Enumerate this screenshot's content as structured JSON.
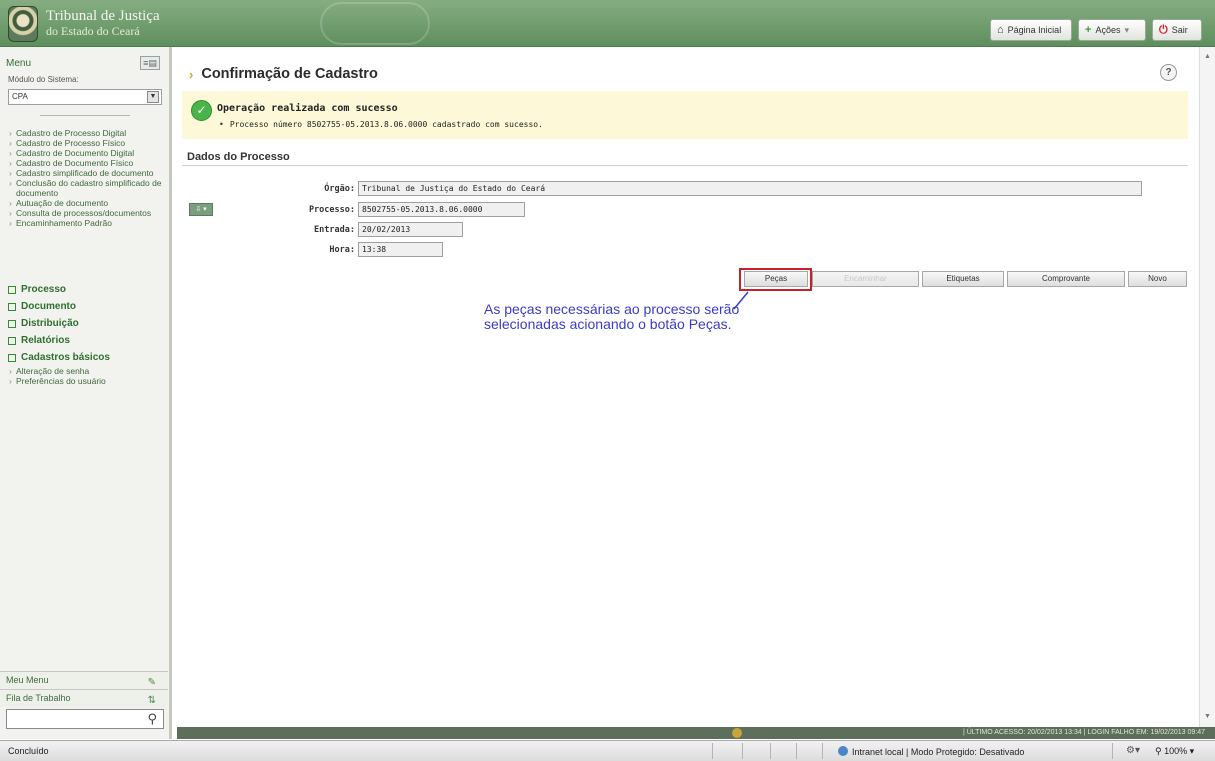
{
  "header": {
    "logo_line1": "Tribunal de Justiça",
    "logo_line2": "do Estado do Ceará",
    "home_label": "Página Inicial",
    "acoes_label": "Ações",
    "acoes_arrow": "▾",
    "sair_label": "Sair"
  },
  "sidebar": {
    "menu_label": "Menu",
    "module_label": "Módulo do Sistema:",
    "module_value": "CPA",
    "submenu": [
      "Cadastro de Processo Digital",
      "Cadastro de Processo Físico",
      "Cadastro de Documento Digital",
      "Cadastro de Documento Físico",
      "Cadastro simplificado de documento",
      "Conclusão do cadastro simplificado de documento",
      "Autuação de documento",
      "Consulta de processos/documentos",
      "Encaminhamento Padrão"
    ],
    "sections": {
      "processo": "Processo",
      "documento": "Documento",
      "distribuicao": "Distribuição",
      "relatorios": "Relatórios",
      "cadastros": "Cadastros básicos",
      "alteracao_senha": "Alteração de senha",
      "preferencias": "Preferências do usuário"
    },
    "meu_menu": "Meu Menu",
    "fila_trabalho": "Fila de Trabalho",
    "search_placeholder": ""
  },
  "main": {
    "title": "Confirmação de Cadastro",
    "help": "?",
    "success_title": "Operação realizada com sucesso",
    "success_detail": "Processo número 8502755-05.2013.8.06.0000 cadastrado com sucesso.",
    "section_title": "Dados do Processo",
    "fields": {
      "orgao_label": "Órgão:",
      "orgao_value": "Tribunal de Justiça do Estado do Ceará",
      "processo_label": "Processo:",
      "processo_value": "8502755-05.2013.8.06.0000",
      "entrada_label": "Entrada:",
      "entrada_value": "20/02/2013",
      "hora_label": "Hora:",
      "hora_value": "13:38"
    },
    "buttons": {
      "pecas": "Peças",
      "encaminhar": "Encaminhar",
      "etiquetas": "Etiquetas",
      "comprovante": "Comprovante",
      "novo": "Novo"
    },
    "callout": "As peças necessárias ao processo serão selecionadas acionando o botão Peças."
  },
  "info_bar": {
    "text": "|  ÚLTIMO ACESSO: 20/02/2013 13:34   |   LOGIN FALHO EM: 19/02/2013 09:47"
  },
  "statusbar": {
    "left": "Concluído",
    "zone": "Intranet local | Modo Protegido: Desativado",
    "zoom": "100%"
  }
}
